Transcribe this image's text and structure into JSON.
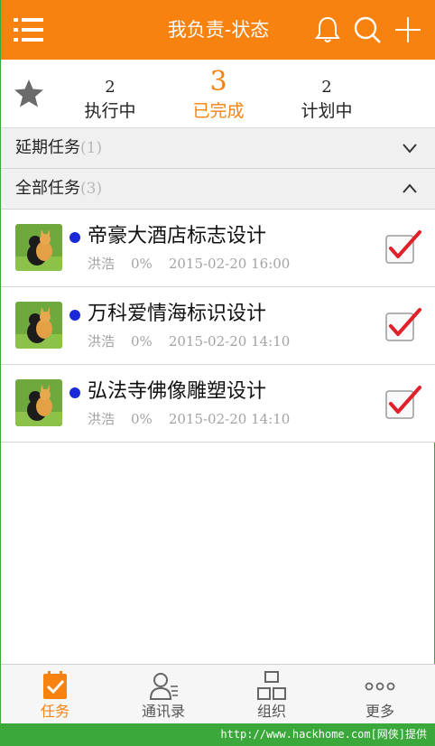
{
  "header": {
    "title": "我负责-状态",
    "icons": [
      "menu-icon",
      "bell-icon",
      "search-icon",
      "plus-icon"
    ]
  },
  "stats": [
    {
      "count": "2",
      "label": "执行中"
    },
    {
      "count": "3",
      "label": "已完成",
      "active": true
    },
    {
      "count": "2",
      "label": "计划中"
    }
  ],
  "sections": {
    "delayed": {
      "title": "延期任务",
      "count": "(1)",
      "expanded": false
    },
    "all": {
      "title": "全部任务",
      "count": "(3)",
      "expanded": true
    }
  },
  "tasks": [
    {
      "name": "帝豪大酒店标志设计",
      "owner": "洪浩",
      "progress": "0%",
      "time": "2015-02-20 16:00",
      "checked": true
    },
    {
      "name": "万科爱情海标识设计",
      "owner": "洪浩",
      "progress": "0%",
      "time": "2015-02-20 14:10",
      "checked": true
    },
    {
      "name": "弘法寺佛像雕塑设计",
      "owner": "洪浩",
      "progress": "0%",
      "time": "2015-02-20 14:10",
      "checked": true
    }
  ],
  "tabs": [
    {
      "label": "任务",
      "icon": "task-icon",
      "active": true
    },
    {
      "label": "通讯录",
      "icon": "contacts-icon"
    },
    {
      "label": "组织",
      "icon": "organization-icon"
    },
    {
      "label": "更多",
      "icon": "more-icon"
    }
  ],
  "banner": {
    "text": "http://www.hackhome.com[网侠]提供"
  },
  "colors": {
    "accent": "#f7820f",
    "dot": "#1a2ad6",
    "check": "#e0202a",
    "banner": "#3aa83a"
  }
}
